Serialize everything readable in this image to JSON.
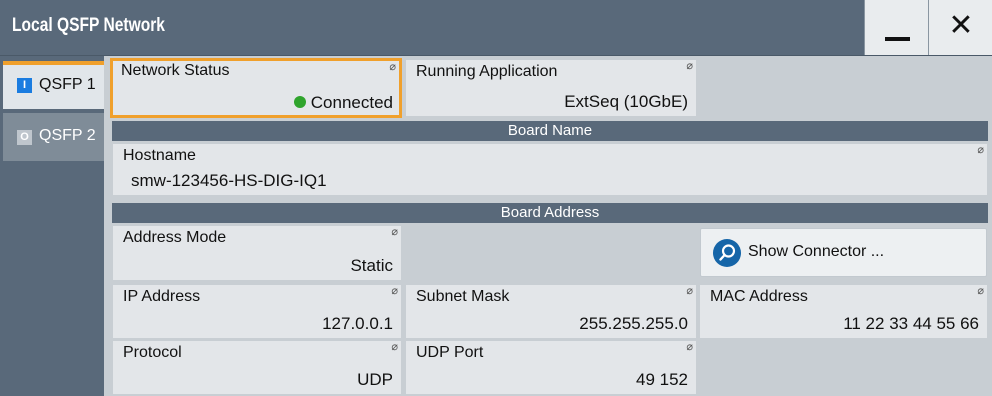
{
  "window": {
    "title": "Local QSFP Network"
  },
  "tabs": [
    {
      "indicator": "I",
      "label": "QSFP 1"
    },
    {
      "indicator": "O",
      "label": "QSFP 2"
    }
  ],
  "network_status": {
    "label": "Network Status",
    "value": "Connected",
    "status_color": "#2fa42c"
  },
  "running_application": {
    "label": "Running Application",
    "value": "ExtSeq (10GbE)"
  },
  "board_name": {
    "header": "Board Name",
    "hostname": {
      "label": "Hostname",
      "value": "smw-123456-HS-DIG-IQ1"
    }
  },
  "board_address": {
    "header": "Board Address",
    "address_mode": {
      "label": "Address Mode",
      "value": "Static"
    },
    "show_connector": {
      "label": "Show Connector ..."
    },
    "ip_address": {
      "label": "IP Address",
      "value": "127.0.0.1"
    },
    "subnet_mask": {
      "label": "Subnet Mask",
      "value": "255.255.255.0"
    },
    "mac_address": {
      "label": "MAC Address",
      "value": "11 22 33 44 55 66"
    },
    "protocol": {
      "label": "Protocol",
      "value": "UDP"
    },
    "udp_port": {
      "label": "UDP Port",
      "value": "49 152"
    }
  },
  "edit_mark": "⌀",
  "colors": {
    "accent": "#f0a02c",
    "header_bg": "#59697a",
    "active_tab_indicator": "#1a7ce0",
    "search_button": "#1565a8"
  }
}
